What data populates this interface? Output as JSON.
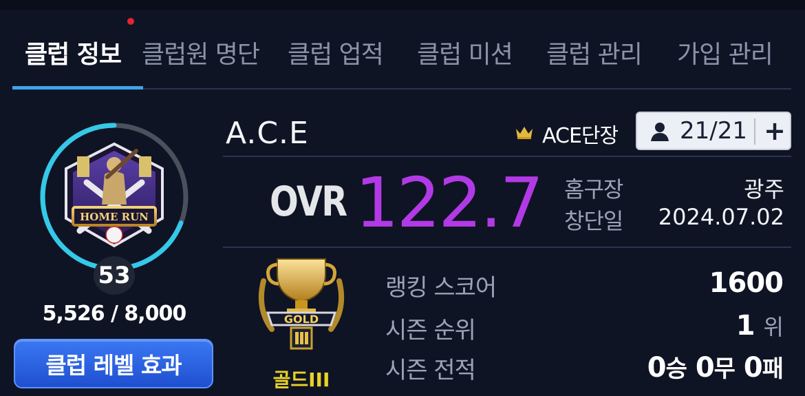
{
  "tabs": [
    {
      "label": "클럽 정보",
      "active": true
    },
    {
      "label": "클럽원 명단",
      "active": false
    },
    {
      "label": "클럽 업적",
      "active": false
    },
    {
      "label": "클럽 미션",
      "active": false
    },
    {
      "label": "클럽 관리",
      "active": false
    },
    {
      "label": "가입 관리",
      "active": false
    }
  ],
  "emblem": {
    "icon": "home-run-emblem",
    "text": "HOME RUN"
  },
  "level": {
    "value": "53",
    "exp_current": 5526,
    "exp_max": 8000,
    "exp_text": "5,526 / 8,000",
    "progress": 0.69075
  },
  "level_effect_button": "클럽 레벨 효과",
  "club": {
    "name": "A.C.E",
    "leader_icon": "crown-icon",
    "leader": "ACE단장",
    "member_icon": "person-icon",
    "members": "21/21",
    "add_icon": "plus-icon",
    "add_label": "+"
  },
  "ovr": {
    "label": "OVR",
    "value": "122.7"
  },
  "info": {
    "home_label": "홈구장",
    "home_value": "광주",
    "founded_label": "창단일",
    "founded_value": "2024.07.02"
  },
  "tier": {
    "icon": "gold-trophy-icon",
    "badge_text": "GOLD",
    "name": "골드III"
  },
  "stats": {
    "ranking_label": "랭킹 스코어",
    "ranking_value": "1600",
    "season_rank_label": "시즌 순위",
    "season_rank_value": "1",
    "season_rank_unit": "위",
    "season_record_label": "시즌 전적",
    "wins": "0",
    "win_unit": "승",
    "draws": "0",
    "draw_unit": "무",
    "losses": "0",
    "loss_unit": "패"
  },
  "colors": {
    "accent": "#3da4e8",
    "ovr": "#b23ae6",
    "tier": "#e8d22a",
    "background": "#0f1424",
    "button": "#2a62e0"
  }
}
